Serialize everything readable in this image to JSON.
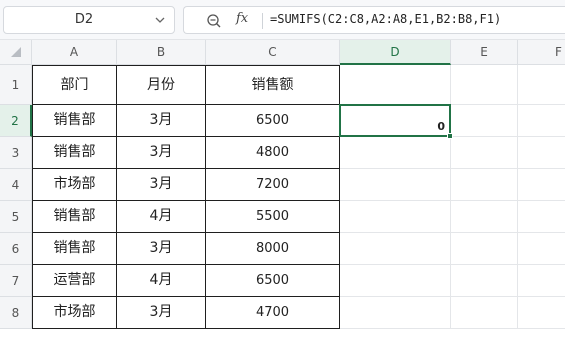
{
  "name_box": {
    "value": "D2"
  },
  "formula_bar": {
    "fx_label": "fx",
    "formula": "=SUMIFS(C2:C8,A2:A8,E1,B2:B8,F1)"
  },
  "columns": [
    "A",
    "B",
    "C",
    "D",
    "E",
    "F"
  ],
  "active_column": "D",
  "rows": [
    "1",
    "2",
    "3",
    "4",
    "5",
    "6",
    "7",
    "8"
  ],
  "active_row": "2",
  "table": {
    "headers": [
      "部门",
      "月份",
      "销售额"
    ],
    "data": [
      [
        "销售部",
        "3月",
        "6500"
      ],
      [
        "销售部",
        "3月",
        "4800"
      ],
      [
        "市场部",
        "3月",
        "7200"
      ],
      [
        "销售部",
        "4月",
        "5500"
      ],
      [
        "销售部",
        "3月",
        "8000"
      ],
      [
        "运营部",
        "4月",
        "6500"
      ],
      [
        "市场部",
        "3月",
        "4700"
      ]
    ]
  },
  "selected_cell": {
    "ref": "D2",
    "value": "0"
  },
  "colors": {
    "accent": "#217346",
    "header_bg": "#f4f5f7",
    "active_header_bg": "#e4f1ea"
  }
}
